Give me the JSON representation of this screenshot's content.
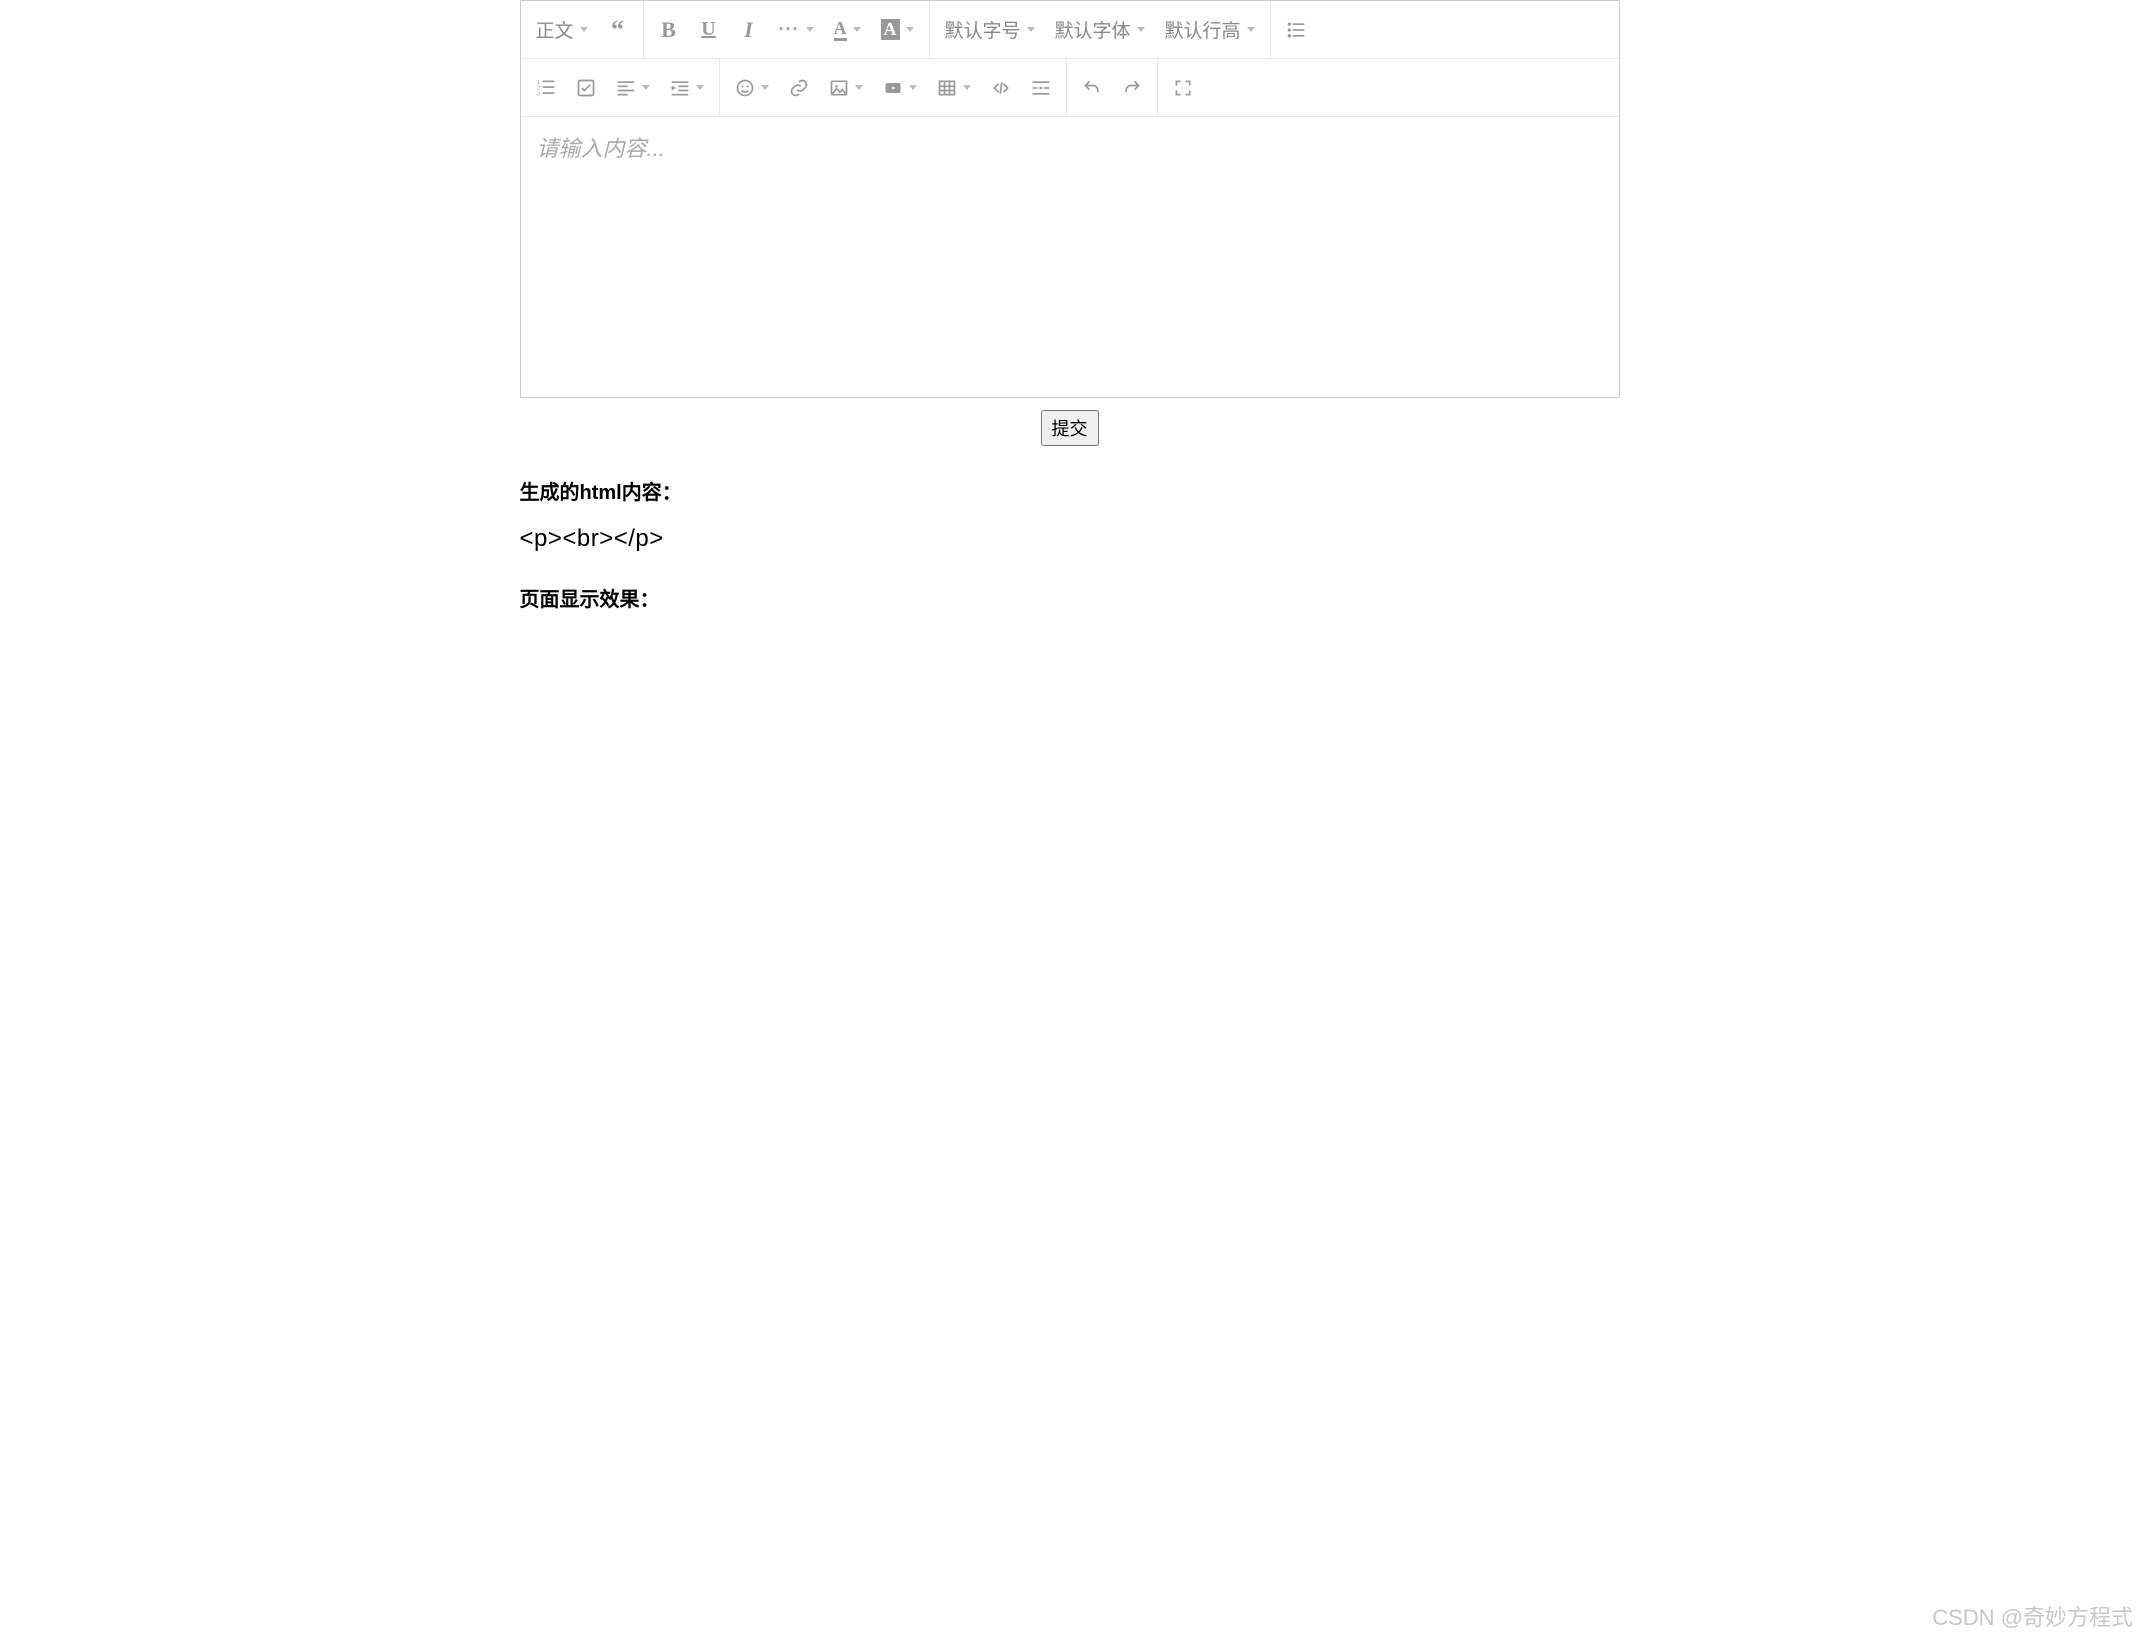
{
  "toolbar": {
    "row1": {
      "heading_label": "正文",
      "fontsize_label": "默认字号",
      "fontfamily_label": "默认字体",
      "lineheight_label": "默认行高",
      "bold_glyph": "B",
      "underline_glyph": "U",
      "italic_glyph": "I",
      "more_glyph": "···",
      "forecolor_glyph": "A",
      "backcolor_glyph": "A",
      "quote_glyph": "“"
    }
  },
  "editor": {
    "placeholder": "请输入内容..."
  },
  "submit": {
    "label": "提交"
  },
  "output": {
    "heading1": "生成的html内容：",
    "code": "<p><br></p>",
    "heading2": "页面显示效果："
  },
  "watermark": "CSDN @奇妙方程式"
}
